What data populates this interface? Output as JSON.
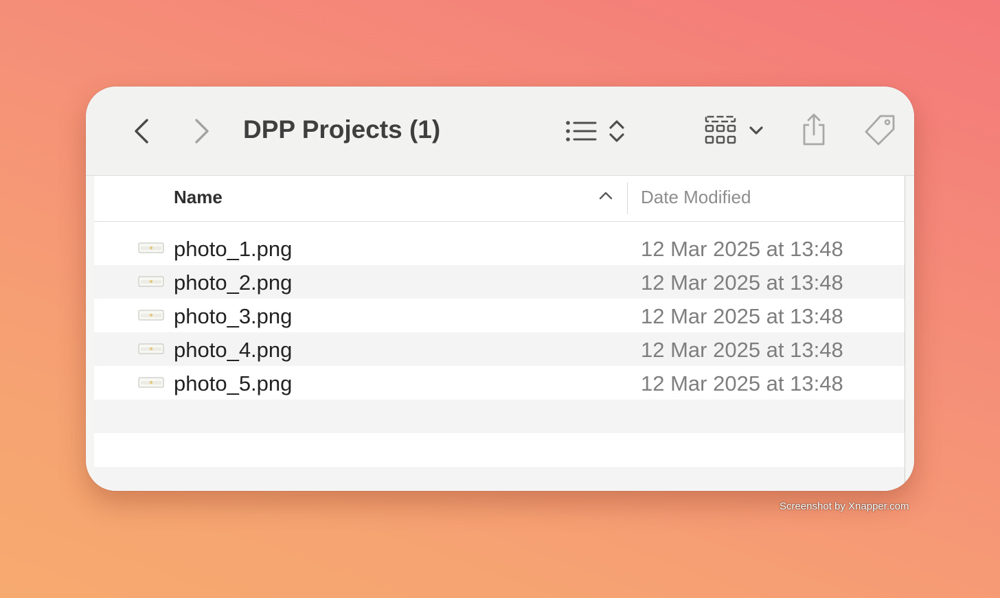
{
  "window": {
    "title": "DPP Projects (1)"
  },
  "toolbar": {
    "icons": {
      "back": "chevron-left-icon",
      "forward": "chevron-right-icon",
      "list_view": "list-icon",
      "sort": "up-down-chevron-icon",
      "group": "grid-icon",
      "group_menu": "chevron-down-icon",
      "share": "share-icon",
      "tag": "tag-icon"
    }
  },
  "columns": {
    "name": "Name",
    "date_modified": "Date Modified",
    "sort_direction": "ascending"
  },
  "files": [
    {
      "name": "photo_1.png",
      "date": "12 Mar 2025 at 13:48"
    },
    {
      "name": "photo_2.png",
      "date": "12 Mar 2025 at 13:48"
    },
    {
      "name": "photo_3.png",
      "date": "12 Mar 2025 at 13:48"
    },
    {
      "name": "photo_4.png",
      "date": "12 Mar 2025 at 13:48"
    },
    {
      "name": "photo_5.png",
      "date": "12 Mar 2025 at 13:48"
    }
  ],
  "watermark": "Screenshot by Xnapper.com",
  "colors": {
    "background_top": "#f4797a",
    "background_bottom": "#f7aa6f",
    "toolbar": "#f2f2f1",
    "row_alt": "#f3f4f3",
    "title_text": "#3f3f3f",
    "date_text": "#7e7e7e"
  }
}
